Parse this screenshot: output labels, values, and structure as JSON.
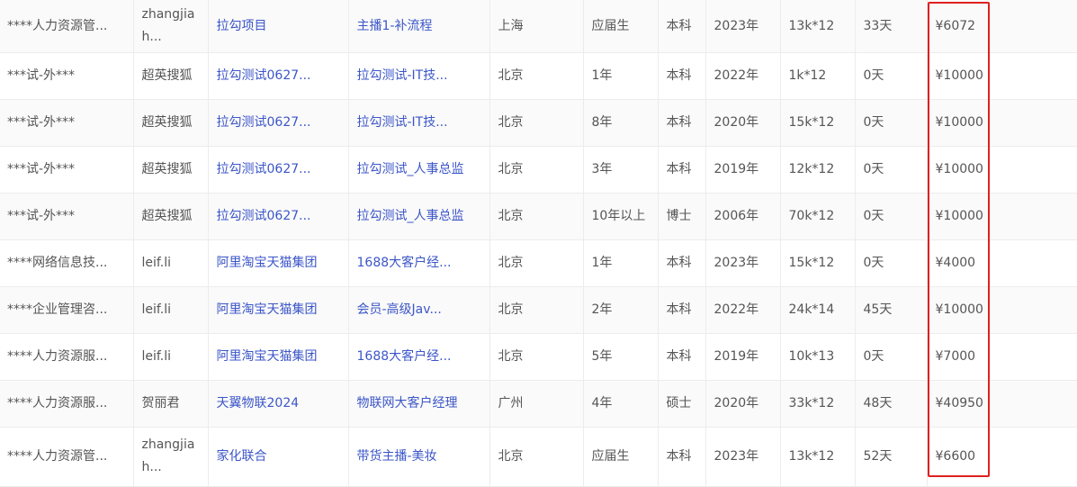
{
  "rows": [
    {
      "company": "****人力资源管...",
      "recruiter": "zhangjiah...",
      "project": "拉勾项目",
      "position": "主播1-补流程",
      "city": "上海",
      "experience": "应届生",
      "education": "本科",
      "grad_year": "2023年",
      "salary": "13k*12",
      "days": "33天",
      "fee": "¥6072"
    },
    {
      "company": "***试-外***",
      "recruiter": "超英搜狐",
      "project": "拉勾测试0627...",
      "position": "拉勾测试-IT技...",
      "city": "北京",
      "experience": "1年",
      "education": "本科",
      "grad_year": "2022年",
      "salary": "1k*12",
      "days": "0天",
      "fee": "¥10000"
    },
    {
      "company": "***试-外***",
      "recruiter": "超英搜狐",
      "project": "拉勾测试0627...",
      "position": "拉勾测试-IT技...",
      "city": "北京",
      "experience": "8年",
      "education": "本科",
      "grad_year": "2020年",
      "salary": "15k*12",
      "days": "0天",
      "fee": "¥10000"
    },
    {
      "company": "***试-外***",
      "recruiter": "超英搜狐",
      "project": "拉勾测试0627...",
      "position": "拉勾测试_人事总监",
      "city": "北京",
      "experience": "3年",
      "education": "本科",
      "grad_year": "2019年",
      "salary": "12k*12",
      "days": "0天",
      "fee": "¥10000"
    },
    {
      "company": "***试-外***",
      "recruiter": "超英搜狐",
      "project": "拉勾测试0627...",
      "position": "拉勾测试_人事总监",
      "city": "北京",
      "experience": "10年以上",
      "education": "博士",
      "grad_year": "2006年",
      "salary": "70k*12",
      "days": "0天",
      "fee": "¥10000"
    },
    {
      "company": "****网络信息技...",
      "recruiter": "leif.li",
      "project": "阿里淘宝天猫集团",
      "position": "1688大客户经...",
      "city": "北京",
      "experience": "1年",
      "education": "本科",
      "grad_year": "2023年",
      "salary": "15k*12",
      "days": "0天",
      "fee": "¥4000"
    },
    {
      "company": "****企业管理咨...",
      "recruiter": "leif.li",
      "project": "阿里淘宝天猫集团",
      "position": "会员-高级Jav...",
      "city": "北京",
      "experience": "2年",
      "education": "本科",
      "grad_year": "2022年",
      "salary": "24k*14",
      "days": "45天",
      "fee": "¥10000"
    },
    {
      "company": "****人力资源服...",
      "recruiter": "leif.li",
      "project": "阿里淘宝天猫集团",
      "position": "1688大客户经...",
      "city": "北京",
      "experience": "5年",
      "education": "本科",
      "grad_year": "2019年",
      "salary": "10k*13",
      "days": "0天",
      "fee": "¥7000"
    },
    {
      "company": "****人力资源服...",
      "recruiter": "贺丽君",
      "project": "天翼物联2024",
      "position": "物联网大客户经理",
      "city": "广州",
      "experience": "4年",
      "education": "硕士",
      "grad_year": "2020年",
      "salary": "33k*12",
      "days": "48天",
      "fee": "¥40950"
    },
    {
      "company": "****人力资源管...",
      "recruiter": "zhangjiah...",
      "project": "家化联合",
      "position": "带货主播-美妆",
      "city": "北京",
      "experience": "应届生",
      "education": "本科",
      "grad_year": "2023年",
      "salary": "13k*12",
      "days": "52天",
      "fee": "¥6600"
    }
  ]
}
